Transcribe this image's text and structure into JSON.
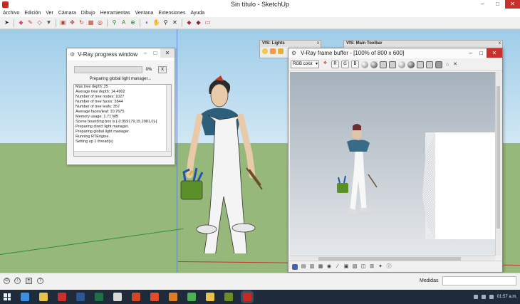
{
  "window": {
    "title": "Sin título - SketchUp",
    "minimize": "–",
    "maximize": "□",
    "close": "✕"
  },
  "menu": [
    "Archivo",
    "Edición",
    "Ver",
    "Cámara",
    "Dibujo",
    "Herramientas",
    "Ventana",
    "Extensiones",
    "Ayuda"
  ],
  "toolbar_tools": [
    {
      "name": "select",
      "glyph": "➤",
      "color": "#1c1c1c"
    },
    {
      "name": "eraser",
      "glyph": "◆",
      "color": "#d94a7a"
    },
    {
      "name": "pencil",
      "glyph": "✎",
      "color": "#c0392b"
    },
    {
      "name": "shape",
      "glyph": "◇",
      "color": "#b13b3b"
    },
    {
      "name": "paint-bucket",
      "glyph": "▼",
      "color": "#6b4f2a"
    },
    {
      "name": "push-pull",
      "glyph": "▣",
      "color": "#c0392b"
    },
    {
      "name": "move",
      "glyph": "✥",
      "color": "#c0392b"
    },
    {
      "name": "rotate",
      "glyph": "↻",
      "color": "#c0392b"
    },
    {
      "name": "scale",
      "glyph": "▦",
      "color": "#c0392b"
    },
    {
      "name": "offset",
      "glyph": "◎",
      "color": "#c0392b"
    },
    {
      "name": "tape-measure",
      "glyph": "⚲",
      "color": "#2e7d32"
    },
    {
      "name": "text",
      "glyph": "A",
      "color": "#2e7d32"
    },
    {
      "name": "dimension",
      "glyph": "⊕",
      "color": "#2e7d32"
    },
    {
      "name": "orbit",
      "glyph": "◐",
      "color": "#3a5fc8"
    },
    {
      "name": "pan",
      "glyph": "✋",
      "color": "#d89a2b"
    },
    {
      "name": "zoom",
      "glyph": "⚲",
      "color": "#1c1c1c"
    },
    {
      "name": "zoom-extents",
      "glyph": "✕",
      "color": "#1c1c1c"
    },
    {
      "name": "warehouse",
      "glyph": "◆",
      "color": "#b12b2b"
    },
    {
      "name": "extension-warehouse",
      "glyph": "◆",
      "color": "#8a1f1f"
    },
    {
      "name": "layout",
      "glyph": "▭",
      "color": "#b12b2b"
    }
  ],
  "progress_window": {
    "title": "V-Ray progress window",
    "progress": 0,
    "percent_label": "0%",
    "button_label": "X",
    "status": "Preparing global light manager...",
    "log": [
      "Max tree depth: 25",
      "Average tree depth: 14.4902",
      "Number of tree nodes: 1027",
      "Number of tree faces: 3844",
      "Number of tree leafs: 357",
      "Average faces/leaf: 10.7675",
      "Memory usage: 1.71 MB",
      "Scene bounding box is [-0.959179,15.2081,0]-[",
      "Preparing direct light manager.",
      "Preparing global light manager.",
      "Running RTEngine",
      "Setting up 1 thread(s)"
    ]
  },
  "lights_toolbar": {
    "title": "VfS: Lights",
    "close": "x"
  },
  "main_toolbar": {
    "title": "VfS: Main Toolbar",
    "close": "x"
  },
  "frame_buffer": {
    "title": "V-Ray frame buffer - [100% of 800 x 600]",
    "channel": "RGB color",
    "channel_buttons": [
      "R",
      "G",
      "B"
    ]
  },
  "status_bar": {
    "measurements_label": "Medidas"
  },
  "taskbar": {
    "apps": [
      {
        "name": "ie",
        "color": "#3a8ee6"
      },
      {
        "name": "explorer",
        "color": "#e8c24a"
      },
      {
        "name": "acrobat",
        "color": "#c9302c"
      },
      {
        "name": "word",
        "color": "#2b5797"
      },
      {
        "name": "excel",
        "color": "#1e7145"
      },
      {
        "name": "mail",
        "color": "#d9d9d9"
      },
      {
        "name": "ppt",
        "color": "#d24726"
      },
      {
        "name": "media",
        "color": "#e34b2b"
      },
      {
        "name": "paint",
        "color": "#e07c24"
      },
      {
        "name": "chrome",
        "color": "#4caf50"
      },
      {
        "name": "folder",
        "color": "#e8c24a"
      },
      {
        "name": "photos",
        "color": "#6b8e23"
      },
      {
        "name": "sketchup",
        "color": "#c8281e"
      }
    ],
    "clock": "01:57 a.m."
  }
}
